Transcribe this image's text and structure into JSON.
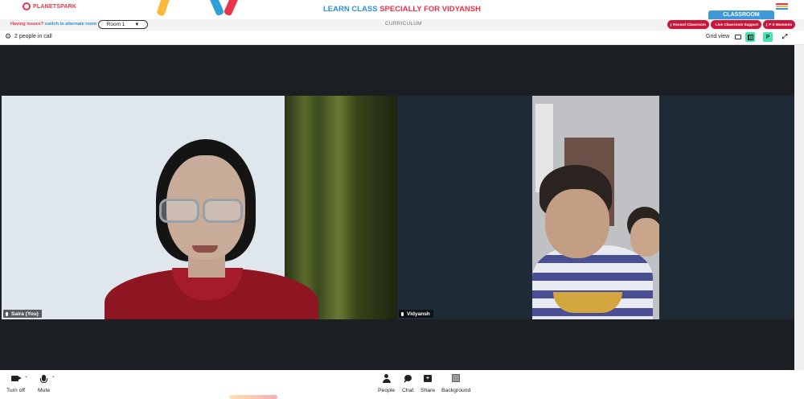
{
  "header": {
    "brand": "PLANETSPARK",
    "title_part1": "LEARN CLASS ",
    "title_part2": "SPECIALLY FOR VIDYANSH",
    "classroom_tab": "CLASSROOM",
    "menu_icon": "hamburger-icon",
    "colors": {
      "blue": "#2f8fd8",
      "red": "#e8334a",
      "tab": "#3d9ad6",
      "pill": "#c8173b"
    }
  },
  "subbar": {
    "issue_text": "Having issues?",
    "issue_link": "switch to alternate room",
    "room_selected": "Room 1",
    "curriculum": "CURRICULUM",
    "pills": [
      "Record Classroom",
      "Live Classroom Support",
      "P S Moments"
    ]
  },
  "meeting": {
    "people_count": "2 people in call",
    "grid_label": "Grid view",
    "pip_label": "P",
    "icons": [
      "gear-icon",
      "speaker-view-icon",
      "grid-view-icon",
      "expand-icon"
    ]
  },
  "participants": [
    {
      "name": "Saira (You)"
    },
    {
      "name": "Vidyansh"
    }
  ],
  "controls": {
    "camera": "Turn off",
    "mic": "Mute",
    "people": "People",
    "chat": "Chat",
    "share": "Share",
    "background": "Background"
  }
}
